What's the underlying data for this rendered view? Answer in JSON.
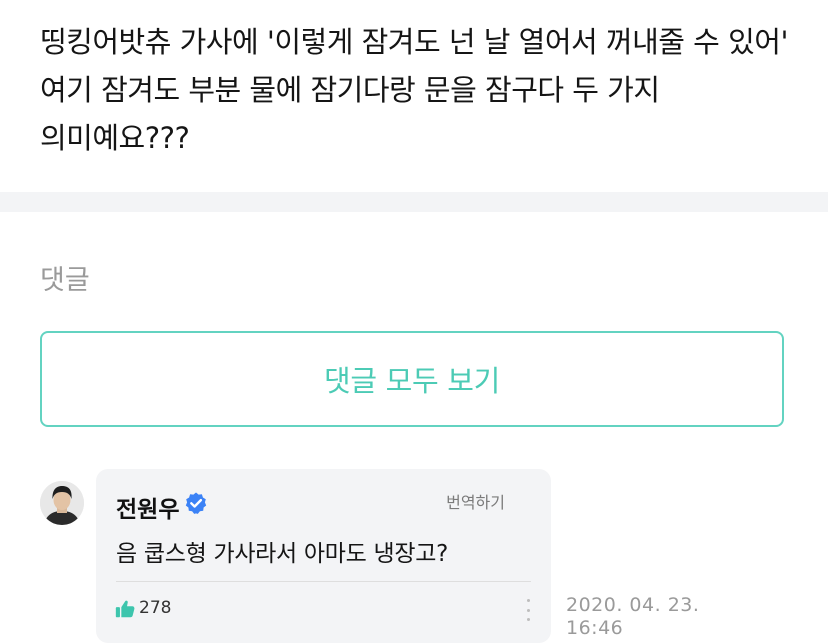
{
  "post": {
    "text": "띵킹어밧츄 가사에 '이렇게 잠겨도 넌 날 열어서 꺼내줄 수 있어' 여기 잠겨도 부분 물에 잠기다랑 문을 잠구다 두 가지 의미예요???"
  },
  "comments": {
    "label": "댓글",
    "view_all_label": "댓글 모두 보기",
    "items": [
      {
        "author": "전원우",
        "verified": true,
        "translate_label": "번역하기",
        "text": "음 쿱스형 가사라서 아마도 냉장고?",
        "likes": "278",
        "date": "2020. 04. 23.",
        "time": "16:46"
      }
    ]
  },
  "colors": {
    "accent": "#4ccbb5",
    "verified": "#3b82f6",
    "like": "#3dc5ad"
  },
  "icons": {
    "verified": "verified-badge-icon",
    "like": "thumbs-up-icon",
    "more": "more-vertical-icon"
  }
}
